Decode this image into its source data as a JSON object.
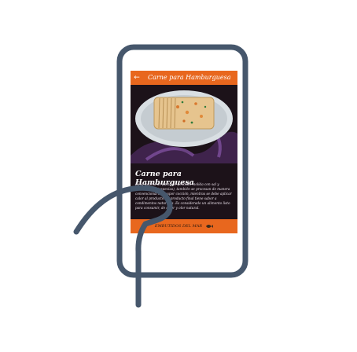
{
  "colors": {
    "phone_outline": "#46576c",
    "app_bar": "#e8671e",
    "screen_background": "#1c1219",
    "accent_purple": "#6a3d86"
  },
  "app_bar": {
    "back_icon": "arrow-left-icon",
    "title": "Carne para Hamburguesa"
  },
  "product": {
    "image_icon": "burger-patty-photo",
    "headline": "Carne para Hamburguesa",
    "description": "Es la mezcla de pasta de pescado molida con sal y condimentos (especias), también se procesan de manera convencional con vapor cocción, mientras se debe aplicar calor al producto. El producto final tiene sabor a condimentos naturales. Es considerado un alimento listo para consumir, de color y olor natural."
  },
  "footer": {
    "brand": "EMBUTIDOS DEL MAR",
    "brand_icon": "fish-icon"
  }
}
